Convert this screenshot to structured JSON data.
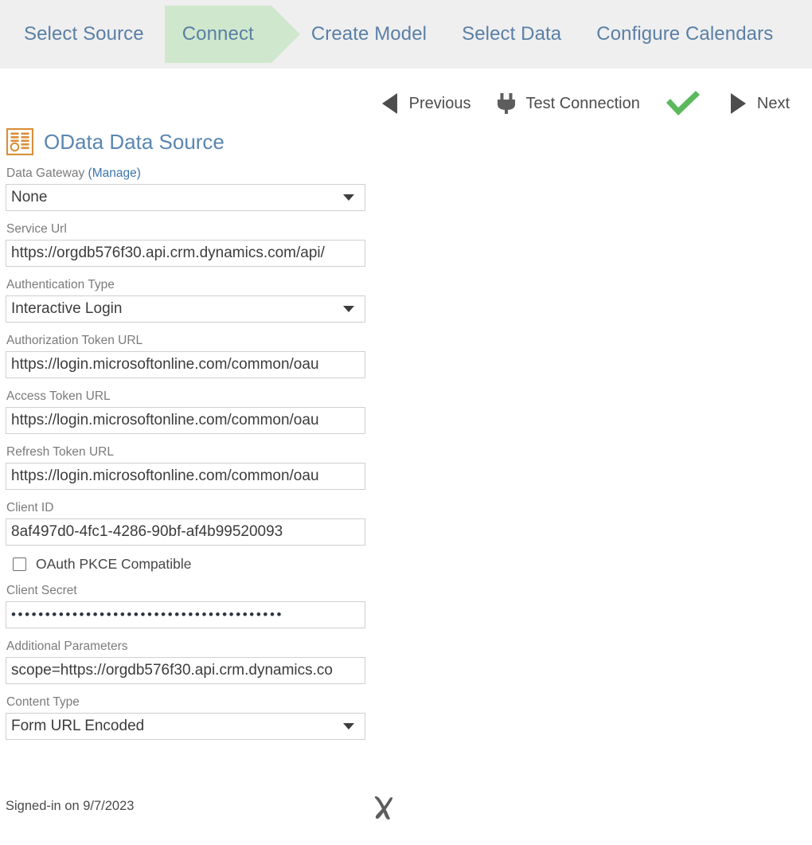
{
  "wizard": {
    "steps": [
      {
        "label": "Select Source",
        "active": false
      },
      {
        "label": "Connect",
        "active": true
      },
      {
        "label": "Create Model",
        "active": false
      },
      {
        "label": "Select Data",
        "active": false
      },
      {
        "label": "Configure Calendars",
        "active": false
      }
    ],
    "active_color": "#cfe8cd",
    "text_color": "#5a7fa6",
    "bar_background": "#efefef"
  },
  "toolbar": {
    "previous_label": "Previous",
    "previous_icon": "chevron-left-icon",
    "test_connection_label": "Test Connection",
    "test_connection_icon": "plug-icon",
    "status_icon": "green-checkmark-icon",
    "status_color": "#5cb85c",
    "next_label": "Next",
    "next_icon": "chevron-right-icon"
  },
  "datasource": {
    "icon": "odata-grid-icon",
    "icon_color": "#d98e3a",
    "title": "OData Data Source",
    "title_color": "#5a86b0"
  },
  "form": {
    "data_gateway": {
      "label": "Data Gateway",
      "link_label": "(Manage)",
      "value": "None"
    },
    "service_url": {
      "label": "Service Url",
      "value": "https://orgdb576f30.api.crm.dynamics.com/api/"
    },
    "authentication_type": {
      "label": "Authentication Type",
      "value": "Interactive Login"
    },
    "authorization_token_url": {
      "label": "Authorization Token URL",
      "value": "https://login.microsoftonline.com/common/oau"
    },
    "access_token_url": {
      "label": "Access Token URL",
      "value": "https://login.microsoftonline.com/common/oau"
    },
    "refresh_token_url": {
      "label": "Refresh Token URL",
      "value": "https://login.microsoftonline.com/common/oau"
    },
    "client_id": {
      "label": "Client ID",
      "value": "8af497d0-4fc1-4286-90bf-af4b99520093"
    },
    "oauth_pkce": {
      "label": "OAuth PKCE Compatible",
      "checked": false
    },
    "client_secret": {
      "label": "Client Secret",
      "value": "••••••••••••••••••••••••••••••••••••••••"
    },
    "additional_parameters": {
      "label": "Additional Parameters",
      "value": "scope=https://orgdb576f30.api.crm.dynamics.co"
    },
    "content_type": {
      "label": "Content Type",
      "value": "Form URL Encoded"
    }
  },
  "footer": {
    "signed_in_text": "Signed-in on 9/7/2023",
    "signout_icon": "x-signout-icon"
  }
}
